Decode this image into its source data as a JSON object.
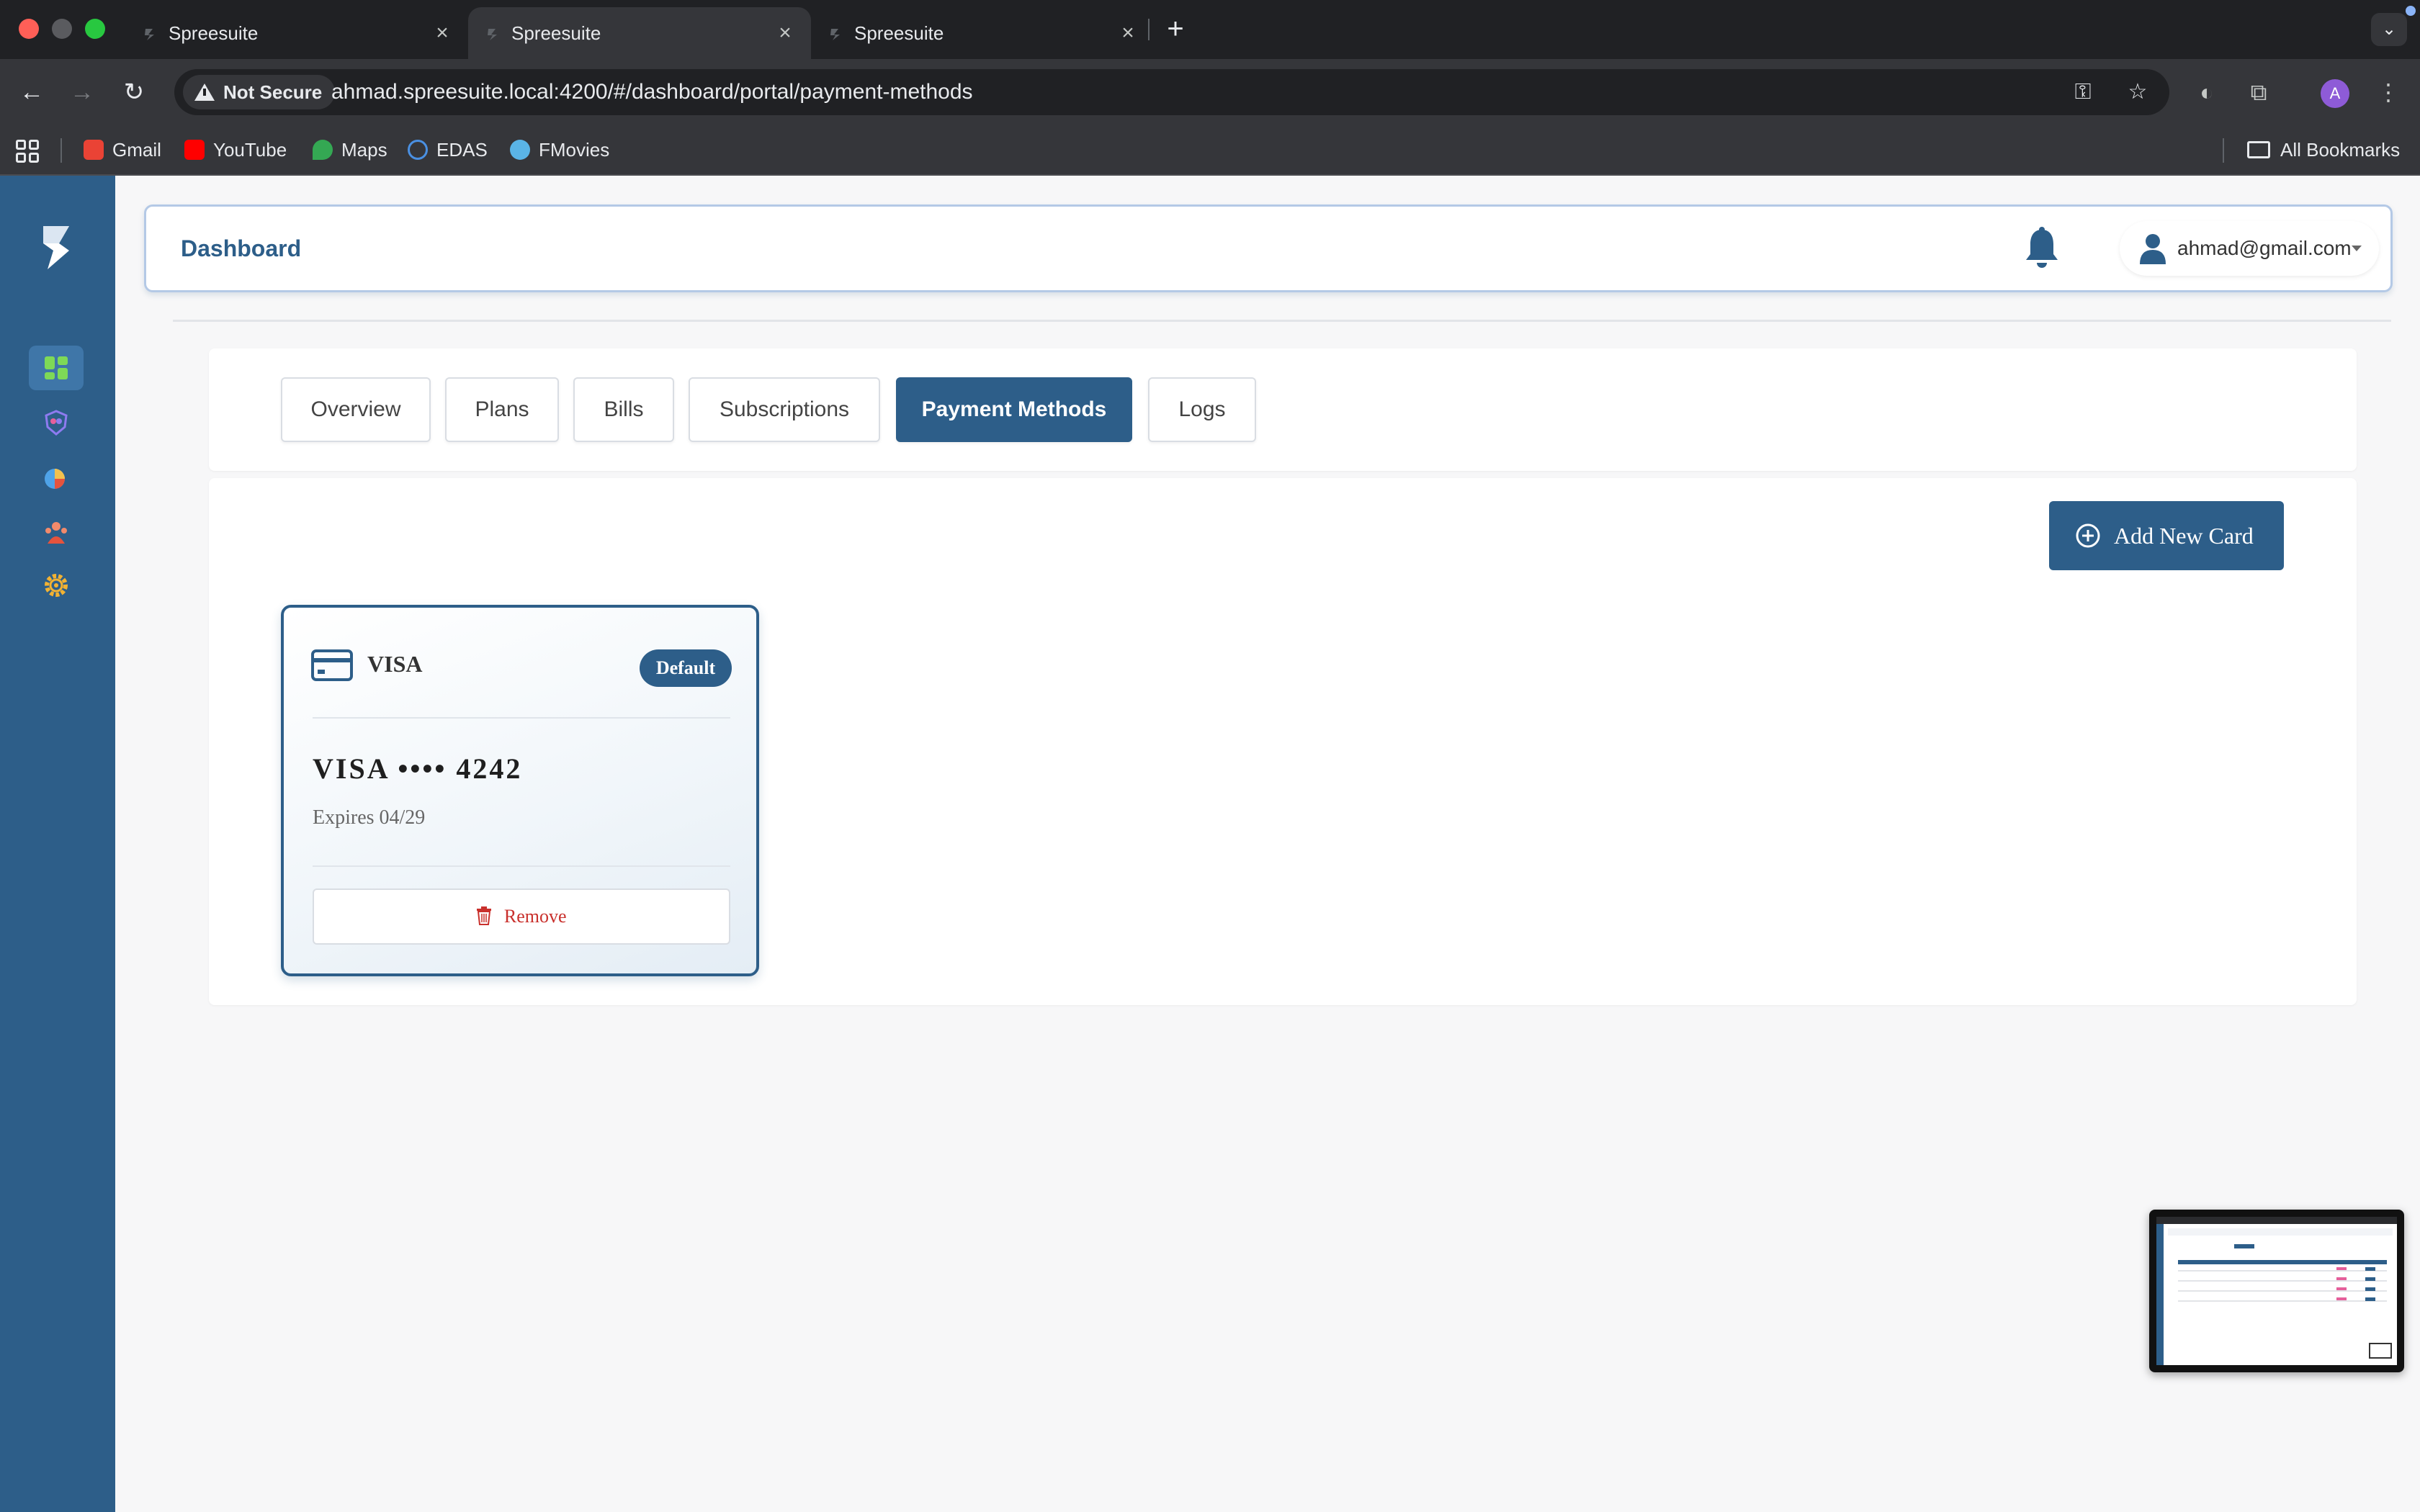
{
  "browser": {
    "tabs": [
      {
        "title": "Spreesuite",
        "active": false
      },
      {
        "title": "Spreesuite",
        "active": true
      },
      {
        "title": "Spreesuite",
        "active": false
      }
    ],
    "not_secure_label": "Not Secure",
    "url": "ahmad.spreesuite.local:4200/#/dashboard/portal/payment-methods",
    "profile_initial": "A",
    "bookmarks": [
      {
        "label": "Gmail",
        "color": "#ea4335"
      },
      {
        "label": "YouTube",
        "color": "#ff0000"
      },
      {
        "label": "Maps",
        "color": "#34a853"
      },
      {
        "label": "EDAS",
        "color": "#4a90e2"
      },
      {
        "label": "FMovies",
        "color": "#5ab4e6"
      }
    ],
    "all_bookmarks_label": "All Bookmarks"
  },
  "sidebar": {
    "items": [
      {
        "icon": "dashboard-icon",
        "active": true
      },
      {
        "icon": "shield-users-icon",
        "active": false
      },
      {
        "icon": "pie-chart-icon",
        "active": false
      },
      {
        "icon": "team-icon",
        "active": false
      },
      {
        "icon": "gear-icon",
        "active": false
      }
    ]
  },
  "header": {
    "title": "Dashboard",
    "user_email": "ahmad@gmail.com"
  },
  "tabs": {
    "items": [
      "Overview",
      "Plans",
      "Bills",
      "Subscriptions",
      "Payment Methods",
      "Logs"
    ],
    "active": "Payment Methods"
  },
  "payment_methods": {
    "add_button_label": "Add New Card",
    "cards": [
      {
        "brand": "VISA",
        "badge": "Default",
        "number_display": "VISA •••• 4242",
        "expiry": "Expires 04/29",
        "remove_label": "Remove"
      }
    ]
  },
  "colors": {
    "primary": "#2d5e89",
    "danger": "#c9302c",
    "background": "#f7f7f8"
  }
}
